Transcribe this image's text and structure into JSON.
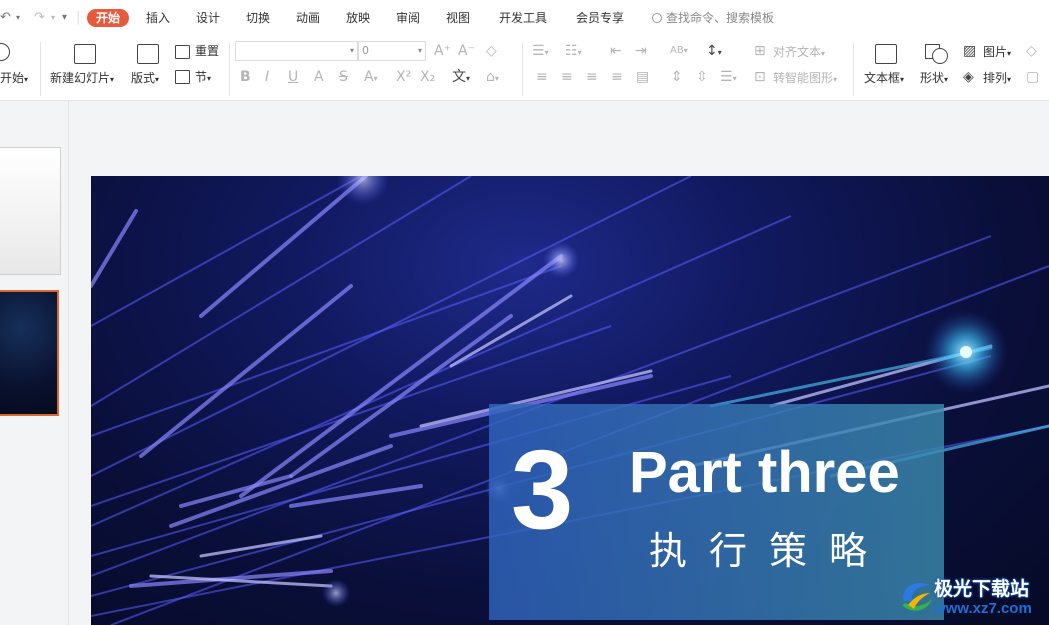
{
  "quick_access": {
    "undo_icon": "↶",
    "redo_icon": "↷",
    "more_icon": "▾"
  },
  "menu": {
    "tabs": [
      "开始",
      "插入",
      "设计",
      "切换",
      "动画",
      "放映",
      "审阅",
      "视图",
      "开发工具",
      "会员专享"
    ],
    "search_placeholder": "查找命令、搜索模板"
  },
  "ribbon": {
    "start_label": "开始",
    "new_slide_label": "新建幻灯片",
    "layout_label": "版式",
    "reset_label": "重置",
    "section_label": "节",
    "font_name_value": "",
    "font_size_value": "0",
    "align_text_label": "对齐文本",
    "smartart_label": "转智能图形",
    "textbox_label": "文本框",
    "shape_label": "形状",
    "picture_label": "图片",
    "arrange_label": "排列"
  },
  "slide": {
    "number": "3",
    "title": "Part three",
    "subtitle": "执行策略"
  },
  "watermark": {
    "text": "极光下载站",
    "url": "www.xz7.com"
  },
  "colors": {
    "accent": "#e85a3c",
    "selected_thumb_border": "#d9692f",
    "slide_bg": "#0a0f3a",
    "title_box": "#3064be"
  }
}
